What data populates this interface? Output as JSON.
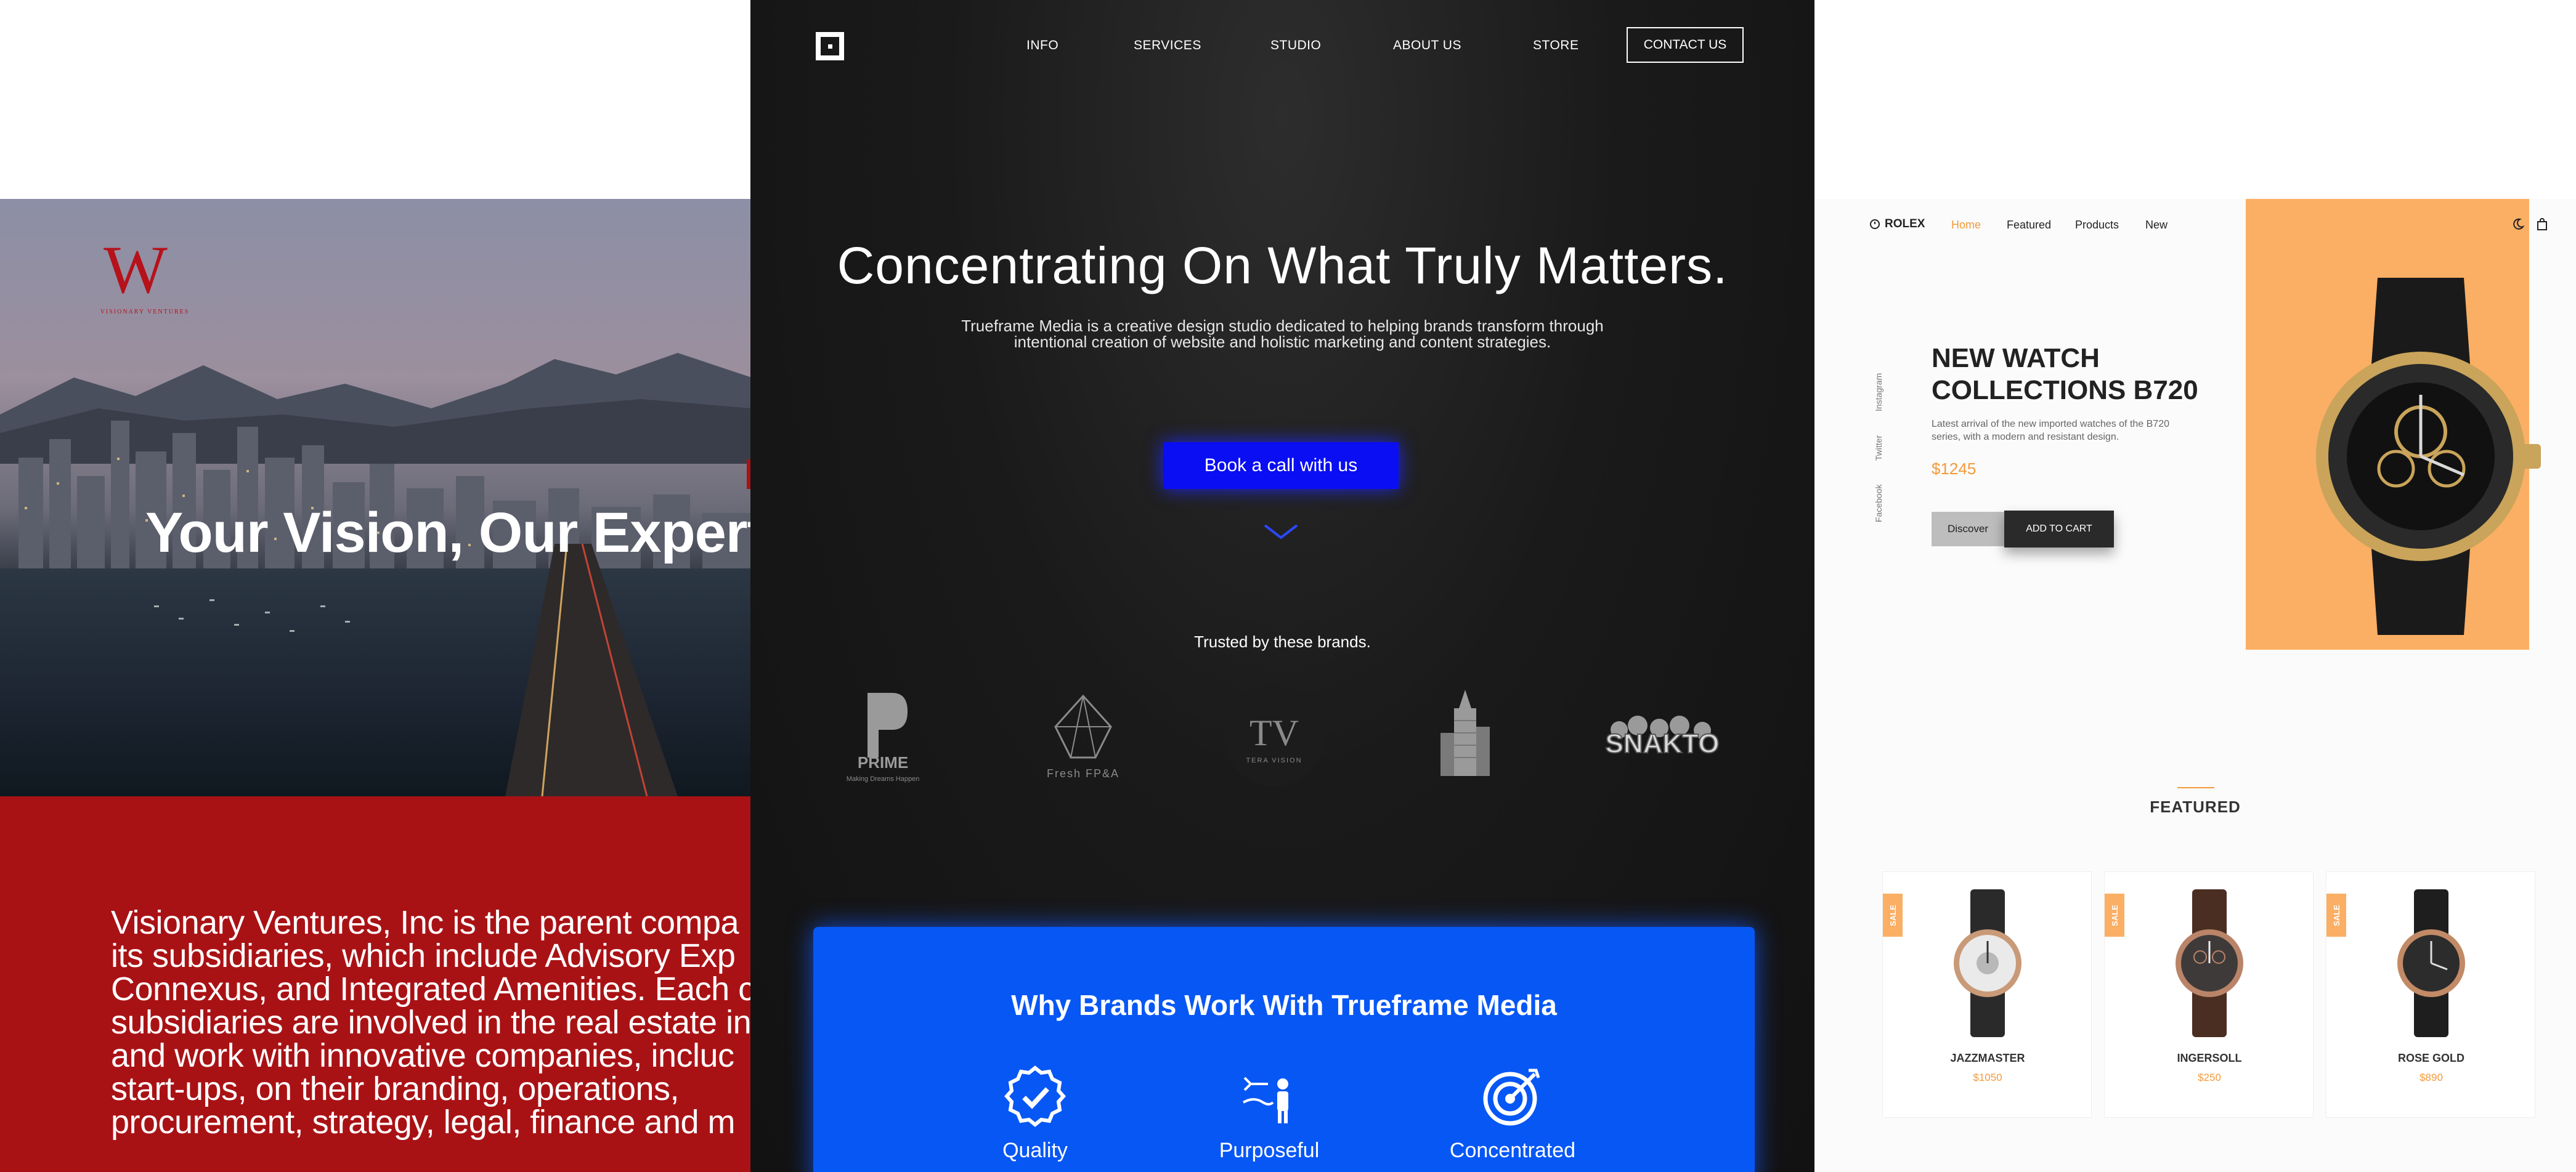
{
  "visionary": {
    "logo_text": "VISIONARY VENTURES",
    "hero_title": "Your Vision, Our Expert",
    "body_text": "Visionary Ventures, Inc is the parent compa\nits subsidiaries, which include Advisory Exp\nConnexus, and Integrated Amenities. Each c\nsubsidiaries are involved in the real estate in\nand work with innovative companies, incluc\nstart-ups, on their branding, operations,\nprocurement, strategy, legal, finance and m",
    "colors": {
      "brand_red": "#a91215"
    }
  },
  "trueframe": {
    "nav": [
      "INFO",
      "SERVICES",
      "STUDIO",
      "ABOUT US",
      "STORE"
    ],
    "contact_label": "CONTACT US",
    "headline": "Concentrating On What Truly Matters.",
    "subheadline": "Trueframe Media is a creative design studio dedicated to helping brands transform through\nintentional creation of website and holistic marketing and content  strategies.",
    "cta_label": "Book a call with us",
    "trusted_label": "Trusted by these brands.",
    "brands": [
      {
        "name": "PRIME",
        "caption": "Making Dreams Happen"
      },
      {
        "name": "Fresh FP&A",
        "caption": ""
      },
      {
        "name": "TERA VISION",
        "caption": ""
      },
      {
        "name": "skyline-logo",
        "caption": ""
      },
      {
        "name": "SNAKTO",
        "caption": ""
      }
    ],
    "why_title": "Why Brands Work With Trueframe Media",
    "features": [
      "Quality",
      "Purposeful",
      "Concentrated"
    ],
    "colors": {
      "cta": "#0a0ef2",
      "panel": "#0757f5"
    }
  },
  "rolex": {
    "brand": "ROLEX",
    "nav": [
      "Home",
      "Featured",
      "Products",
      "New"
    ],
    "active_nav": "Home",
    "social": [
      "Instagram",
      "Twitter",
      "Facebook"
    ],
    "title": "NEW WATCH\nCOLLECTIONS B720",
    "description": "Latest arrival of the new imported watches of the B720\nseries, with a modern and resistant design.",
    "price": "$1245",
    "discover_label": "Discover",
    "add_to_cart_label": "ADD TO CART",
    "featured_title": "FEATURED",
    "products": [
      {
        "name": "JAZZMASTER",
        "price": "$1050",
        "badge": "SALE"
      },
      {
        "name": "INGERSOLL",
        "price": "$250",
        "badge": "SALE"
      },
      {
        "name": "ROSE GOLD",
        "price": "$890",
        "badge": "SALE"
      }
    ],
    "colors": {
      "accent": "#f39a3b",
      "hero_bg": "#fbaf64"
    }
  }
}
